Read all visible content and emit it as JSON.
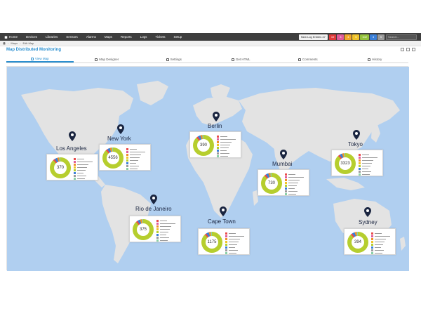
{
  "nav": {
    "items": [
      "Home",
      "Devices",
      "Libraries",
      "Sensors",
      "Alarms",
      "Maps",
      "Reports",
      "Logs",
      "Tickets",
      "Setup"
    ],
    "log_button": "New Log Entries",
    "log_count": "47",
    "badges": [
      {
        "text": "19",
        "color": "#e03a3a"
      },
      {
        "text": "3",
        "color": "#e05a9a"
      },
      {
        "text": "4",
        "color": "#f2a72a"
      },
      {
        "text": "5",
        "color": "#f0c32a"
      },
      {
        "text": "102",
        "color": "#94c23b"
      },
      {
        "text": "3",
        "color": "#3a7fd8"
      },
      {
        "text": "5",
        "color": "#9b9b9b"
      }
    ],
    "search_placeholder": "Search..."
  },
  "breadcrumb": {
    "items": [
      "Maps",
      "Edit Map"
    ]
  },
  "page": {
    "title": "Map Distributed Monitoring"
  },
  "tabs": [
    {
      "label": "View Map",
      "active": true
    },
    {
      "label": "Map Designer",
      "active": false
    },
    {
      "label": "Settings",
      "active": false
    },
    {
      "label": "Get HTML",
      "active": false
    },
    {
      "label": "Comments",
      "active": false
    },
    {
      "label": "History",
      "active": false
    }
  ],
  "map": {
    "ocean_color": "#b0cff0",
    "land_color": "#e3e3e3",
    "pin_color": "#1a2540",
    "cities": [
      {
        "name": "Los Angeles",
        "value": "370"
      },
      {
        "name": "New York",
        "value": "4556"
      },
      {
        "name": "Berlin",
        "value": "390"
      },
      {
        "name": "Mumbai",
        "value": "730"
      },
      {
        "name": "Tokyo",
        "value": "3323"
      },
      {
        "name": "Rio de Janeiro",
        "value": "375"
      },
      {
        "name": "Cape Town",
        "value": "1175"
      },
      {
        "name": "Sydney",
        "value": "394"
      }
    ],
    "legend_colors": [
      "#e94b4b",
      "#e05a9a",
      "#ef8f2a",
      "#f0c32a",
      "#b6ce2e",
      "#3a7fd8",
      "#9b9b9b",
      "#8ad0a8"
    ]
  }
}
